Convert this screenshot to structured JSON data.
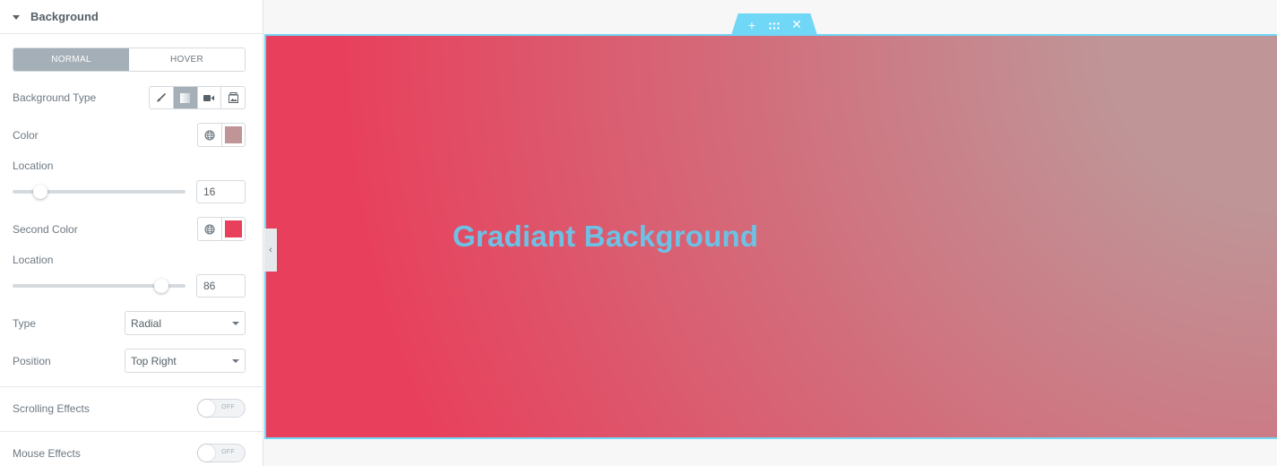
{
  "panel": {
    "section_title": "Background",
    "state_tabs": [
      {
        "label": "NORMAL",
        "active": true
      },
      {
        "label": "HOVER",
        "active": false
      }
    ],
    "background_type": {
      "label": "Background Type",
      "options": [
        {
          "name": "classic",
          "icon": "brush-icon",
          "active": false
        },
        {
          "name": "gradient",
          "icon": "gradient-icon",
          "active": true
        },
        {
          "name": "video",
          "icon": "video-camera-icon",
          "active": false
        },
        {
          "name": "slideshow",
          "icon": "slideshow-icon",
          "active": false
        }
      ]
    },
    "color": {
      "label": "Color",
      "value": "#bf9597",
      "icon": "globe-icon"
    },
    "location1": {
      "label": "Location",
      "value": "16",
      "percent": 16
    },
    "second_color": {
      "label": "Second Color",
      "value": "#e8405c",
      "icon": "globe-icon"
    },
    "location2": {
      "label": "Location",
      "value": "86",
      "percent": 86
    },
    "type": {
      "label": "Type",
      "value": "Radial"
    },
    "position": {
      "label": "Position",
      "value": "Top Right"
    },
    "scrolling_effects": {
      "label": "Scrolling Effects",
      "state": "OFF"
    },
    "mouse_effects": {
      "label": "Mouse Effects",
      "state": "OFF"
    }
  },
  "canvas": {
    "headline": "Gradiant Background",
    "headline_color": "#6ec1e4",
    "accent_color": "#71d7f7",
    "handle_buttons": [
      {
        "name": "add-section-button",
        "glyph": "+"
      },
      {
        "name": "drag-section-handle",
        "glyph": "⠿"
      },
      {
        "name": "delete-section-button",
        "glyph": "✕"
      }
    ],
    "collapse_glyph": "‹"
  }
}
